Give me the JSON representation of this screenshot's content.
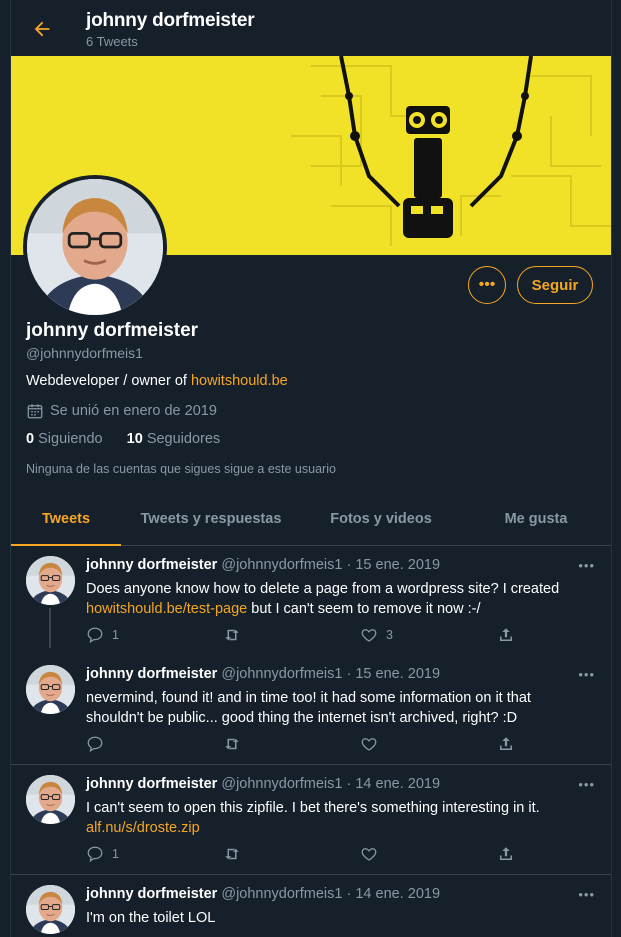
{
  "header": {
    "name": "johnny dorfmeister",
    "tweet_count": "6 Tweets"
  },
  "profile": {
    "name": "johnny dorfmeister",
    "handle": "@johnnydorfmeis1",
    "bio_text": "Webdeveloper / owner of ",
    "bio_link": "howitshould.be",
    "joined": "Se unió en enero de 2019",
    "following_count": "0",
    "following_label": "Siguiendo",
    "followers_count": "10",
    "followers_label": "Seguidores",
    "note": "Ninguna de las cuentas que sigues sigue a este usuario",
    "more_label": "•••",
    "follow_label": "Seguir"
  },
  "tabs": [
    {
      "label": "Tweets"
    },
    {
      "label": "Tweets y respuestas"
    },
    {
      "label": "Fotos y videos"
    },
    {
      "label": "Me gusta"
    }
  ],
  "tweets": [
    {
      "name": "johnny dorfmeister",
      "meta": "@johnnydorfmeis1 · 15 ene. 2019",
      "text_a": "Does anyone know how to delete a page from a wordpress site? I created ",
      "link": "howitshould.be/test-page",
      "text_b": " but I can't seem to remove it now :-/",
      "replies": "1",
      "retweets": "",
      "likes": "3"
    },
    {
      "name": "johnny dorfmeister",
      "meta": "@johnnydorfmeis1 · 15 ene. 2019",
      "text_a": "nevermind, found it! and in time too! it had some information on it that shouldn't be public... good thing the internet isn't archived, right? :D",
      "link": "",
      "text_b": "",
      "replies": "",
      "retweets": "",
      "likes": ""
    },
    {
      "name": "johnny dorfmeister",
      "meta": "@johnnydorfmeis1 · 14 ene. 2019",
      "text_a": "I can't seem to open this zipfile. I bet there's something interesting in it. ",
      "link": "alf.nu/s/droste.zip",
      "text_b": "",
      "replies": "1",
      "retweets": "",
      "likes": ""
    },
    {
      "name": "johnny dorfmeister",
      "meta": "@johnnydorfmeis1 · 14 ene. 2019",
      "text_a": "I'm on the toilet LOL",
      "link": "",
      "text_b": "",
      "replies": "",
      "retweets": "",
      "likes": ""
    }
  ],
  "colors": {
    "accent": "#f5a623",
    "background": "#15202b",
    "muted": "#8899a6",
    "banner": "#f2e227"
  }
}
